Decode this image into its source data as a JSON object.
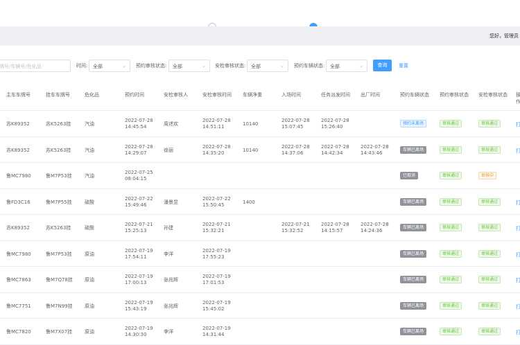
{
  "header": {
    "greeting": "您好，管理员"
  },
  "filters": {
    "search_placeholder": "牌号/车辆号/危化品",
    "time_label": "时间:",
    "time_value": "全部",
    "pre_audit_label": "预约审核状态:",
    "pre_audit_value": "全部",
    "safety_audit_label": "安检审核状态:",
    "safety_audit_value": "全部",
    "vehicle_status_label": "预约车辆状态:",
    "vehicle_status_value": "全部",
    "query_label": "查询",
    "reset_label": "重置"
  },
  "table": {
    "columns": [
      "主车车牌号",
      "挂车车牌号",
      "危化品",
      "预约时间",
      "安检审核人",
      "安检审核时间",
      "车辆净重",
      "入场时间",
      "任务派发时间",
      "出厂时间",
      "预约车辆状态",
      "预约审核状态",
      "安检审核状态",
      "操作"
    ],
    "rows": [
      {
        "main_plate": "苏K89352",
        "trailer_plate": "苏K5263挂",
        "chemical": "汽油",
        "appoint_time": [
          "2022-07-28",
          "14:45:54"
        ],
        "reviewer": "周述欢",
        "review_time": [
          "2022-07-28",
          "14:51:11"
        ],
        "net_weight": "10140",
        "entry_time": [
          "2022-07-28",
          "15:07:45"
        ],
        "dispatch_time": [
          "2022-07-28",
          "15:26:40"
        ],
        "exit_time": [
          "",
          ""
        ],
        "vehicle_status": "预约未离场",
        "vehicle_status_color": "blue",
        "pre_audit": "审核通过",
        "pre_audit_color": "green",
        "safety_audit": "审核通过",
        "safety_audit_color": "green",
        "action": "打"
      },
      {
        "main_plate": "苏K89352",
        "trailer_plate": "苏K5263挂",
        "chemical": "汽油",
        "appoint_time": [
          "2022-07-28",
          "14:29:07"
        ],
        "reviewer": "徐丽",
        "review_time": [
          "2022-07-28",
          "14:35:20"
        ],
        "net_weight": "10140",
        "entry_time": [
          "2022-07-28",
          "14:37:06"
        ],
        "dispatch_time": [
          "2022-07-28",
          "14:42:34"
        ],
        "exit_time": [
          "2022-07-28",
          "14:43:46"
        ],
        "vehicle_status": "车辆已离场",
        "vehicle_status_color": "grey",
        "pre_audit": "审核通过",
        "pre_audit_color": "green",
        "safety_audit": "审核通过",
        "safety_audit_color": "green",
        "action": "打"
      },
      {
        "main_plate": "鲁MC7980",
        "trailer_plate": "鲁M7P53挂",
        "chemical": "汽油",
        "appoint_time": [
          "2022-07-25",
          "08:04:15"
        ],
        "reviewer": "",
        "review_time": [
          "",
          ""
        ],
        "net_weight": "",
        "entry_time": [
          "",
          ""
        ],
        "dispatch_time": [
          "",
          ""
        ],
        "exit_time": [
          "",
          ""
        ],
        "vehicle_status": "已取消",
        "vehicle_status_color": "grey",
        "pre_audit": "审核通过",
        "pre_audit_color": "green",
        "safety_audit": "审核中",
        "safety_audit_color": "orange",
        "action": ""
      },
      {
        "main_plate": "鲁FD3C16",
        "trailer_plate": "鲁M7P55挂",
        "chemical": "硫酸",
        "appoint_time": [
          "2022-07-22",
          "15:49:46"
        ],
        "reviewer": "潘景昱",
        "review_time": [
          "2022-07-22",
          "15:50:45"
        ],
        "net_weight": "1400",
        "entry_time": [
          "",
          ""
        ],
        "dispatch_time": [
          "",
          ""
        ],
        "exit_time": [
          "",
          ""
        ],
        "vehicle_status": "车辆已离场",
        "vehicle_status_color": "grey",
        "pre_audit": "审核通过",
        "pre_audit_color": "green",
        "safety_audit": "审核通过",
        "safety_audit_color": "green",
        "action": "打"
      },
      {
        "main_plate": "苏K89352",
        "trailer_plate": "苏K5263挂",
        "chemical": "硫酸",
        "appoint_time": [
          "2022-07-21",
          "15:25:13"
        ],
        "reviewer": "孙建",
        "review_time": [
          "2022-07-21",
          "15:32:21"
        ],
        "net_weight": "",
        "entry_time": [
          "2022-07-21",
          "15:32:52"
        ],
        "dispatch_time": [
          "2022-07-28",
          "14:15:57"
        ],
        "exit_time": [
          "2022-07-28",
          "14:24:36"
        ],
        "vehicle_status": "车辆已离场",
        "vehicle_status_color": "grey",
        "pre_audit": "审核通过",
        "pre_audit_color": "green",
        "safety_audit": "审核通过",
        "safety_audit_color": "green",
        "action": "打"
      },
      {
        "main_plate": "鲁MC7980",
        "trailer_plate": "鲁M7P53挂",
        "chemical": "原油",
        "appoint_time": [
          "2022-07-19",
          "17:54:11"
        ],
        "reviewer": "李洋",
        "review_time": [
          "2022-07-19",
          "17:55:23"
        ],
        "net_weight": "",
        "entry_time": [
          "",
          ""
        ],
        "dispatch_time": [
          "",
          ""
        ],
        "exit_time": [
          "",
          ""
        ],
        "vehicle_status": "车辆已离场",
        "vehicle_status_color": "grey",
        "pre_audit": "审核通过",
        "pre_audit_color": "green",
        "safety_audit": "审核通过",
        "safety_audit_color": "green",
        "action": "打"
      },
      {
        "main_plate": "鲁MC7863",
        "trailer_plate": "鲁M7Q78挂",
        "chemical": "原油",
        "appoint_time": [
          "2022-07-19",
          "17:00:13"
        ],
        "reviewer": "张兆辉",
        "review_time": [
          "2022-07-19",
          "17:01:53"
        ],
        "net_weight": "",
        "entry_time": [
          "",
          ""
        ],
        "dispatch_time": [
          "",
          ""
        ],
        "exit_time": [
          "",
          ""
        ],
        "vehicle_status": "车辆已离场",
        "vehicle_status_color": "grey",
        "pre_audit": "审核通过",
        "pre_audit_color": "green",
        "safety_audit": "审核通过",
        "safety_audit_color": "green",
        "action": "打"
      },
      {
        "main_plate": "鲁MC7751",
        "trailer_plate": "鲁M7N99挂",
        "chemical": "原油",
        "appoint_time": [
          "2022-07-19",
          "15:43:19"
        ],
        "reviewer": "张兆辉",
        "review_time": [
          "2022-07-19",
          "15:45:02"
        ],
        "net_weight": "",
        "entry_time": [
          "",
          ""
        ],
        "dispatch_time": [
          "",
          ""
        ],
        "exit_time": [
          "",
          ""
        ],
        "vehicle_status": "车辆已离场",
        "vehicle_status_color": "grey",
        "pre_audit": "审核通过",
        "pre_audit_color": "green",
        "safety_audit": "审核通过",
        "safety_audit_color": "green",
        "action": "打"
      },
      {
        "main_plate": "鲁MC7820",
        "trailer_plate": "鲁M7X07挂",
        "chemical": "原油",
        "appoint_time": [
          "2022-07-19",
          "14:30:30"
        ],
        "reviewer": "李洋",
        "review_time": [
          "2022-07-19",
          "14:31:44"
        ],
        "net_weight": "",
        "entry_time": [
          "",
          ""
        ],
        "dispatch_time": [
          "",
          ""
        ],
        "exit_time": [
          "",
          ""
        ],
        "vehicle_status": "车辆已离场",
        "vehicle_status_color": "grey",
        "pre_audit": "审核通过",
        "pre_audit_color": "green",
        "safety_audit": "审核通过",
        "safety_audit_color": "green",
        "action": "打"
      }
    ]
  }
}
